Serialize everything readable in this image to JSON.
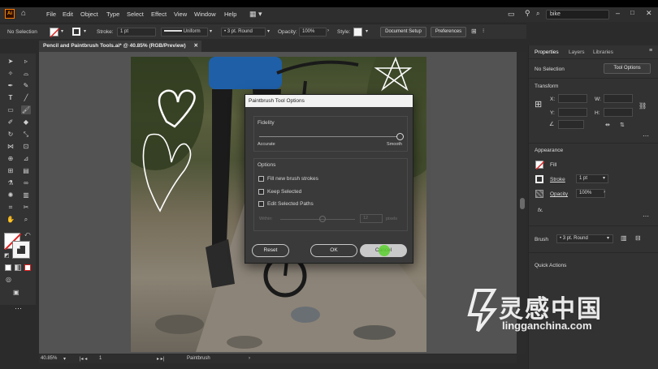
{
  "app": {
    "logo": "Ai"
  },
  "menu": {
    "items": [
      "File",
      "Edit",
      "Object",
      "Type",
      "Select",
      "Effect",
      "View",
      "Window",
      "Help"
    ],
    "search_value": "bike"
  },
  "control": {
    "selection": "No Selection",
    "stroke_label": "Stroke:",
    "stroke_value": "1 pt",
    "profile": "Uniform",
    "brush": "3 pt. Round",
    "opacity_label": "Opacity:",
    "opacity_value": "100%",
    "style_label": "Style:",
    "doc_setup": "Document Setup",
    "preferences": "Preferences"
  },
  "tab": {
    "title": "Pencil and Paintbrush Tools.ai* @ 40.85% (RGB/Preview)"
  },
  "dialog": {
    "title": "Paintbrush Tool Options",
    "fidelity_label": "Fidelity",
    "accurate": "Accurate",
    "smooth": "Smooth",
    "options_label": "Options",
    "opt1": "Fill new brush strokes",
    "opt2": "Keep Selected",
    "opt3": "Edit Selected Paths",
    "within": "Within:",
    "within_value": "12",
    "pixels": "pixels",
    "reset": "Reset",
    "ok": "OK",
    "cancel": "Cancel",
    "fidelity_level": 1.0
  },
  "status": {
    "zoom": "40.85%",
    "artboard": "1",
    "tool": "Paintbrush"
  },
  "panel": {
    "tabs": [
      "Properties",
      "Layers",
      "Libraries"
    ],
    "no_selection": "No Selection",
    "tool_options": "Tool Options",
    "transform": "Transform",
    "x": "X:",
    "y": "Y:",
    "w": "W:",
    "h": "H:",
    "appearance": "Appearance",
    "fill": "Fill",
    "stroke": "Stroke",
    "stroke_value": "1 pt",
    "opacity": "Opacity",
    "opacity_value": "100%",
    "fx": "fx.",
    "brush_label": "Brush",
    "brush_value": "3 pt. Round",
    "quick_actions": "Quick Actions"
  },
  "watermark": {
    "cn": "灵感中国",
    "url": "lingganchina.com"
  },
  "colors": {
    "accent": "#ff9a00",
    "panel": "#323232",
    "pasteboard": "#535353",
    "cursor": "#5cd12f"
  }
}
